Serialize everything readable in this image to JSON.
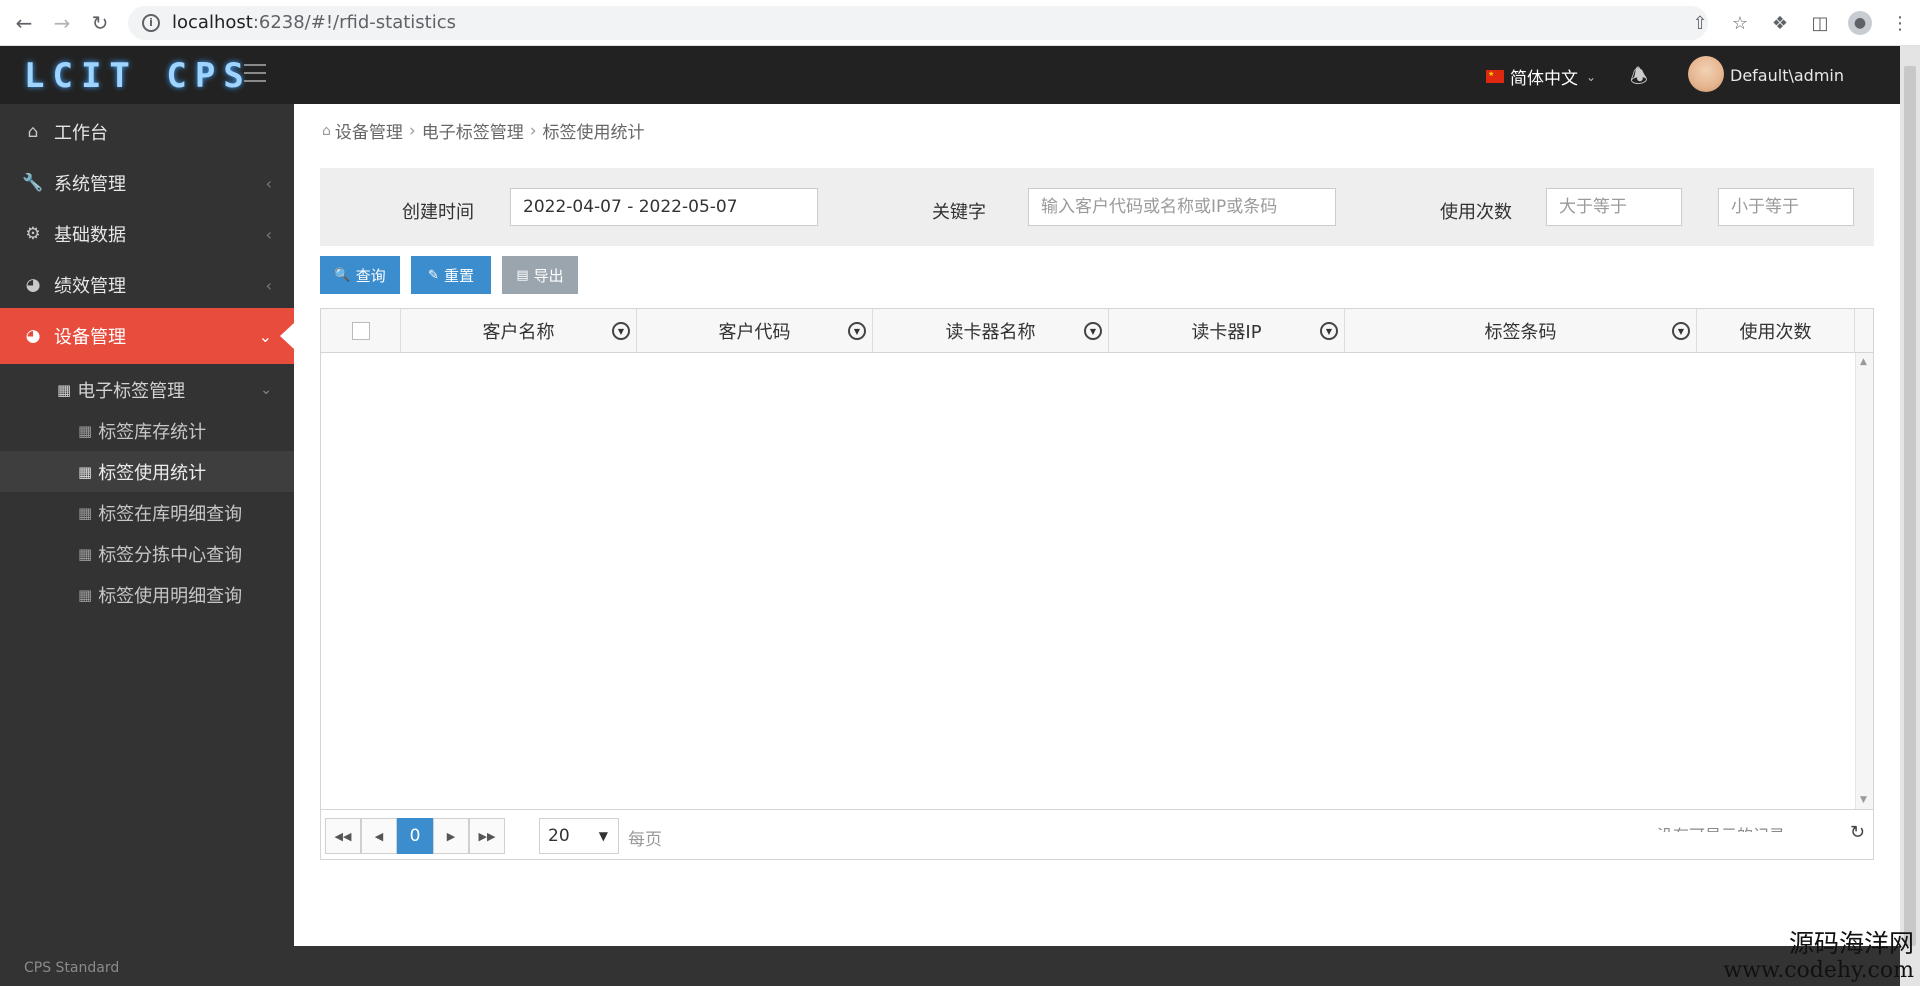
{
  "browser": {
    "url_host": "localhost",
    "url_path": ":6238/#!/rfid-statistics"
  },
  "header": {
    "logo": "LCIT CPS",
    "language": "简体中文",
    "username": "Default\\admin"
  },
  "sidebar": {
    "items": [
      {
        "label": "工作台",
        "icon": "home-icon"
      },
      {
        "label": "系统管理",
        "icon": "wrench-icon"
      },
      {
        "label": "基础数据",
        "icon": "gear-icon"
      },
      {
        "label": "绩效管理",
        "icon": "pie-chart-icon"
      },
      {
        "label": "设备管理",
        "icon": "pie-chart-icon"
      }
    ],
    "submenu": {
      "label": "电子标签管理",
      "children": [
        "标签库存统计",
        "标签使用统计",
        "标签在库明细查询",
        "标签分拣中心查询",
        "标签使用明细查询"
      ]
    },
    "footer": "CPS Standard"
  },
  "breadcrumb": [
    "设备管理",
    "电子标签管理",
    "标签使用统计"
  ],
  "filters": {
    "created_label": "创建时间",
    "created_value": "2022-04-07 - 2022-05-07",
    "keyword_label": "关键字",
    "keyword_placeholder": "输入客户代码或名称或IP或条码",
    "usage_label": "使用次数",
    "usage_min_placeholder": "大于等于",
    "usage_max_placeholder": "小于等于"
  },
  "actions": {
    "search": "查询",
    "reset": "重置",
    "export": "导出"
  },
  "grid": {
    "columns": [
      "客户名称",
      "客户代码",
      "读卡器名称",
      "读卡器IP",
      "标签条码",
      "使用次数"
    ]
  },
  "pager": {
    "current_page": "0",
    "page_size": "20",
    "per_page_label": "每页",
    "no_records": "没有可显示的记录"
  },
  "watermark": {
    "line1": "源码海洋网",
    "line2": "www.codehy.com"
  }
}
